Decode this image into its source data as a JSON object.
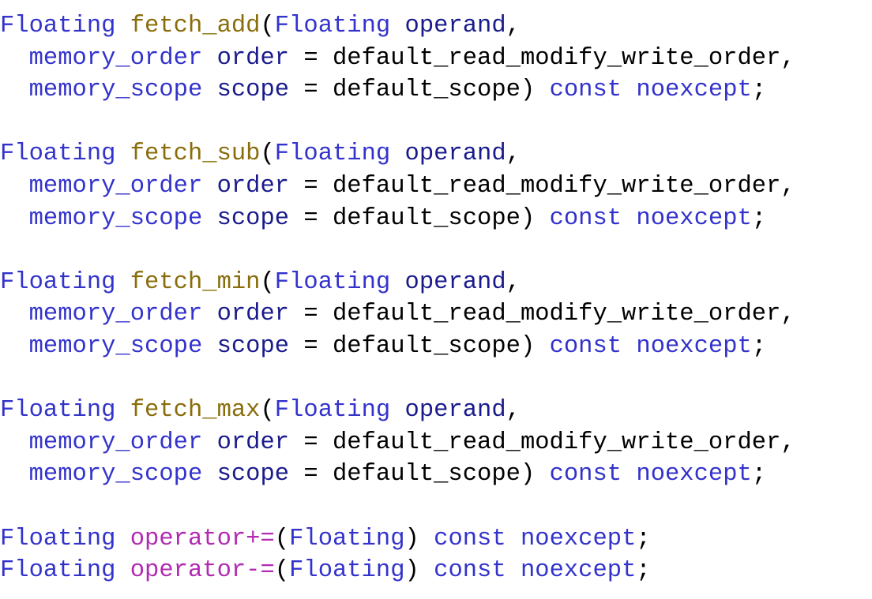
{
  "document": {
    "kind": "source-code-listing",
    "language": "C++",
    "background_color": "#ffffff",
    "font": "monospace-serif"
  },
  "theme": {
    "type_color": "#3333cc",
    "function_color": "#8a6d0b",
    "operator_color": "#b12ab1",
    "parameter_color": "#1a1a8c",
    "keyword_color": "#3333cc",
    "plain_color": "#000000"
  },
  "code": {
    "lines": [
      {
        "id": "line-1",
        "text": "Floating fetch_add(Floating operand,",
        "tokens": [
          {
            "t": "Floating",
            "c": "type"
          },
          {
            "t": " ",
            "c": "plain"
          },
          {
            "t": "fetch_add",
            "c": "func"
          },
          {
            "t": "(",
            "c": "punct"
          },
          {
            "t": "Floating",
            "c": "type"
          },
          {
            "t": " ",
            "c": "plain"
          },
          {
            "t": "operand",
            "c": "param"
          },
          {
            "t": ",",
            "c": "punct"
          }
        ]
      },
      {
        "id": "line-2",
        "text": "  memory_order order = default_read_modify_write_order,",
        "tokens": [
          {
            "t": "  ",
            "c": "plain"
          },
          {
            "t": "memory_order",
            "c": "type"
          },
          {
            "t": " ",
            "c": "plain"
          },
          {
            "t": "order",
            "c": "param"
          },
          {
            "t": " = ",
            "c": "plain"
          },
          {
            "t": "default_read_modify_write_order",
            "c": "plain"
          },
          {
            "t": ",",
            "c": "punct"
          }
        ]
      },
      {
        "id": "line-3",
        "text": "  memory_scope scope = default_scope) const noexcept;",
        "tokens": [
          {
            "t": "  ",
            "c": "plain"
          },
          {
            "t": "memory_scope",
            "c": "type"
          },
          {
            "t": " ",
            "c": "plain"
          },
          {
            "t": "scope",
            "c": "param"
          },
          {
            "t": " = ",
            "c": "plain"
          },
          {
            "t": "default_scope",
            "c": "plain"
          },
          {
            "t": ") ",
            "c": "punct"
          },
          {
            "t": "const",
            "c": "keyword"
          },
          {
            "t": " ",
            "c": "plain"
          },
          {
            "t": "noexcept",
            "c": "keyword"
          },
          {
            "t": ";",
            "c": "punct"
          }
        ]
      },
      {
        "id": "line-4",
        "text": "",
        "tokens": []
      },
      {
        "id": "line-5",
        "text": "Floating fetch_sub(Floating operand,",
        "tokens": [
          {
            "t": "Floating",
            "c": "type"
          },
          {
            "t": " ",
            "c": "plain"
          },
          {
            "t": "fetch_sub",
            "c": "func"
          },
          {
            "t": "(",
            "c": "punct"
          },
          {
            "t": "Floating",
            "c": "type"
          },
          {
            "t": " ",
            "c": "plain"
          },
          {
            "t": "operand",
            "c": "param"
          },
          {
            "t": ",",
            "c": "punct"
          }
        ]
      },
      {
        "id": "line-6",
        "text": "  memory_order order = default_read_modify_write_order,",
        "tokens": [
          {
            "t": "  ",
            "c": "plain"
          },
          {
            "t": "memory_order",
            "c": "type"
          },
          {
            "t": " ",
            "c": "plain"
          },
          {
            "t": "order",
            "c": "param"
          },
          {
            "t": " = ",
            "c": "plain"
          },
          {
            "t": "default_read_modify_write_order",
            "c": "plain"
          },
          {
            "t": ",",
            "c": "punct"
          }
        ]
      },
      {
        "id": "line-7",
        "text": "  memory_scope scope = default_scope) const noexcept;",
        "tokens": [
          {
            "t": "  ",
            "c": "plain"
          },
          {
            "t": "memory_scope",
            "c": "type"
          },
          {
            "t": " ",
            "c": "plain"
          },
          {
            "t": "scope",
            "c": "param"
          },
          {
            "t": " = ",
            "c": "plain"
          },
          {
            "t": "default_scope",
            "c": "plain"
          },
          {
            "t": ") ",
            "c": "punct"
          },
          {
            "t": "const",
            "c": "keyword"
          },
          {
            "t": " ",
            "c": "plain"
          },
          {
            "t": "noexcept",
            "c": "keyword"
          },
          {
            "t": ";",
            "c": "punct"
          }
        ]
      },
      {
        "id": "line-8",
        "text": "",
        "tokens": []
      },
      {
        "id": "line-9",
        "text": "Floating fetch_min(Floating operand,",
        "tokens": [
          {
            "t": "Floating",
            "c": "type"
          },
          {
            "t": " ",
            "c": "plain"
          },
          {
            "t": "fetch_min",
            "c": "func"
          },
          {
            "t": "(",
            "c": "punct"
          },
          {
            "t": "Floating",
            "c": "type"
          },
          {
            "t": " ",
            "c": "plain"
          },
          {
            "t": "operand",
            "c": "param"
          },
          {
            "t": ",",
            "c": "punct"
          }
        ]
      },
      {
        "id": "line-10",
        "text": "  memory_order order = default_read_modify_write_order,",
        "tokens": [
          {
            "t": "  ",
            "c": "plain"
          },
          {
            "t": "memory_order",
            "c": "type"
          },
          {
            "t": " ",
            "c": "plain"
          },
          {
            "t": "order",
            "c": "param"
          },
          {
            "t": " = ",
            "c": "plain"
          },
          {
            "t": "default_read_modify_write_order",
            "c": "plain"
          },
          {
            "t": ",",
            "c": "punct"
          }
        ]
      },
      {
        "id": "line-11",
        "text": "  memory_scope scope = default_scope) const noexcept;",
        "tokens": [
          {
            "t": "  ",
            "c": "plain"
          },
          {
            "t": "memory_scope",
            "c": "type"
          },
          {
            "t": " ",
            "c": "plain"
          },
          {
            "t": "scope",
            "c": "param"
          },
          {
            "t": " = ",
            "c": "plain"
          },
          {
            "t": "default_scope",
            "c": "plain"
          },
          {
            "t": ") ",
            "c": "punct"
          },
          {
            "t": "const",
            "c": "keyword"
          },
          {
            "t": " ",
            "c": "plain"
          },
          {
            "t": "noexcept",
            "c": "keyword"
          },
          {
            "t": ";",
            "c": "punct"
          }
        ]
      },
      {
        "id": "line-12",
        "text": "",
        "tokens": []
      },
      {
        "id": "line-13",
        "text": "Floating fetch_max(Floating operand,",
        "tokens": [
          {
            "t": "Floating",
            "c": "type"
          },
          {
            "t": " ",
            "c": "plain"
          },
          {
            "t": "fetch_max",
            "c": "func"
          },
          {
            "t": "(",
            "c": "punct"
          },
          {
            "t": "Floating",
            "c": "type"
          },
          {
            "t": " ",
            "c": "plain"
          },
          {
            "t": "operand",
            "c": "param"
          },
          {
            "t": ",",
            "c": "punct"
          }
        ]
      },
      {
        "id": "line-14",
        "text": "  memory_order order = default_read_modify_write_order,",
        "tokens": [
          {
            "t": "  ",
            "c": "plain"
          },
          {
            "t": "memory_order",
            "c": "type"
          },
          {
            "t": " ",
            "c": "plain"
          },
          {
            "t": "order",
            "c": "param"
          },
          {
            "t": " = ",
            "c": "plain"
          },
          {
            "t": "default_read_modify_write_order",
            "c": "plain"
          },
          {
            "t": ",",
            "c": "punct"
          }
        ]
      },
      {
        "id": "line-15",
        "text": "  memory_scope scope = default_scope) const noexcept;",
        "tokens": [
          {
            "t": "  ",
            "c": "plain"
          },
          {
            "t": "memory_scope",
            "c": "type"
          },
          {
            "t": " ",
            "c": "plain"
          },
          {
            "t": "scope",
            "c": "param"
          },
          {
            "t": " = ",
            "c": "plain"
          },
          {
            "t": "default_scope",
            "c": "plain"
          },
          {
            "t": ") ",
            "c": "punct"
          },
          {
            "t": "const",
            "c": "keyword"
          },
          {
            "t": " ",
            "c": "plain"
          },
          {
            "t": "noexcept",
            "c": "keyword"
          },
          {
            "t": ";",
            "c": "punct"
          }
        ]
      },
      {
        "id": "line-16",
        "text": "",
        "tokens": []
      },
      {
        "id": "line-17",
        "text": "Floating operator+=(Floating) const noexcept;",
        "tokens": [
          {
            "t": "Floating",
            "c": "type"
          },
          {
            "t": " ",
            "c": "plain"
          },
          {
            "t": "operator+=",
            "c": "operator"
          },
          {
            "t": "(",
            "c": "punct"
          },
          {
            "t": "Floating",
            "c": "type"
          },
          {
            "t": ") ",
            "c": "punct"
          },
          {
            "t": "const",
            "c": "keyword"
          },
          {
            "t": " ",
            "c": "plain"
          },
          {
            "t": "noexcept",
            "c": "keyword"
          },
          {
            "t": ";",
            "c": "punct"
          }
        ]
      },
      {
        "id": "line-18",
        "text": "Floating operator-=(Floating) const noexcept;",
        "tokens": [
          {
            "t": "Floating",
            "c": "type"
          },
          {
            "t": " ",
            "c": "plain"
          },
          {
            "t": "operator-=",
            "c": "operator"
          },
          {
            "t": "(",
            "c": "punct"
          },
          {
            "t": "Floating",
            "c": "type"
          },
          {
            "t": ") ",
            "c": "punct"
          },
          {
            "t": "const",
            "c": "keyword"
          },
          {
            "t": " ",
            "c": "plain"
          },
          {
            "t": "noexcept",
            "c": "keyword"
          },
          {
            "t": ";",
            "c": "punct"
          }
        ]
      }
    ]
  }
}
